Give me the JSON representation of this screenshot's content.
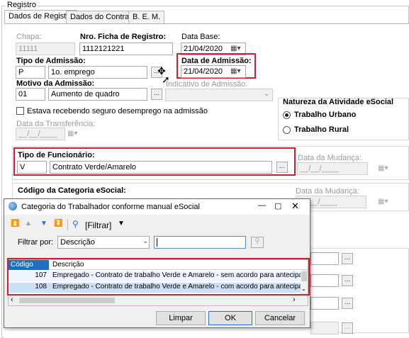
{
  "group_title": "Registro",
  "tabs": [
    "Dados de Registro",
    "Dados do Contrato",
    "B. E. M."
  ],
  "chapa": {
    "label": "Chapa:",
    "value": "11111"
  },
  "ficha": {
    "label": "Nro. Ficha de Registro:",
    "value": "1112121221"
  },
  "data_base": {
    "label": "Data Base:",
    "value": "21/04/2020"
  },
  "tipo_admissao": {
    "label": "Tipo de Admissão:",
    "code": "P",
    "desc": "1o. emprego"
  },
  "data_admissao": {
    "label": "Data de Admissão:",
    "value": "21/04/2020"
  },
  "motivo": {
    "label": "Motivo da Admissão:",
    "code": "01",
    "desc": "Aumento de quadro"
  },
  "indicativo": {
    "label": "Indicativo de Admissão:"
  },
  "seguro_label": "Estava recebendo seguro desemprego na admissão",
  "data_transferencia": {
    "label": "Data da Transferência:",
    "value": "__/__/____"
  },
  "natureza": {
    "title": "Natureza da Atividade eSocial",
    "options": [
      "Trabalho Urbano",
      "Trabalho Rural"
    ],
    "selected": 0
  },
  "tipo_funcionario": {
    "label": "Tipo de Funcionário:",
    "code": "V",
    "desc": "Contrato Verde/Amarelo"
  },
  "data_mudanca": {
    "label": "Data da Mudança:",
    "value": "__/__/____"
  },
  "categoria": {
    "label": "Código da Categoria eSocial:"
  },
  "dots": "...",
  "dialog": {
    "title": "Categoria do Trabalhador conforme manual eSocial",
    "filter_button": "[Filtrar]",
    "filter_by_label": "Filtrar por:",
    "filter_by_value": "Descrição",
    "columns": [
      "Código",
      "Descrição"
    ],
    "rows": [
      {
        "code": "107",
        "desc": "Empregado - Contrato de trabalho Verde e Amarelo - sem acordo para antecipação m"
      },
      {
        "code": "108",
        "desc": "Empregado - Contrato de trabalho Verde e Amarelo - com acordo para antecipação m"
      }
    ],
    "buttons": {
      "clear": "Limpar",
      "ok": "OK",
      "cancel": "Cancelar"
    }
  },
  "colors": {
    "highlight": "#d01f2f",
    "selected_row": "#cce0f5",
    "grid_header": "#1f6fbf"
  }
}
